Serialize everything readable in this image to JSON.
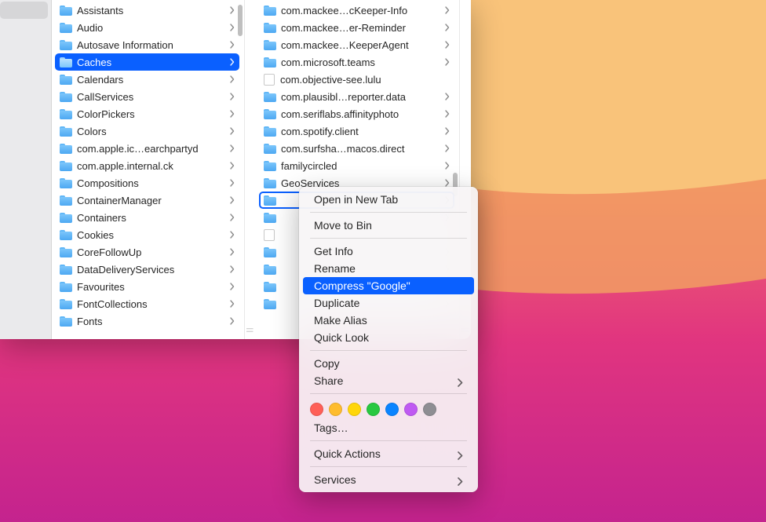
{
  "columns": {
    "col1_selected": "Caches",
    "col1": [
      "Assistants",
      "Audio",
      "Autosave Information",
      "Caches",
      "Calendars",
      "CallServices",
      "ColorPickers",
      "Colors",
      "com.apple.ic…earchpartyd",
      "com.apple.internal.ck",
      "Compositions",
      "ContainerManager",
      "Containers",
      "Cookies",
      "CoreFollowUp",
      "DataDeliveryServices",
      "Favourites",
      "FontCollections",
      "Fonts"
    ],
    "col2_focused_index": 11,
    "col2": [
      {
        "name": "com.mackee…cKeeper-Info",
        "type": "folder"
      },
      {
        "name": "com.mackee…er-Reminder",
        "type": "folder"
      },
      {
        "name": "com.mackee…KeeperAgent",
        "type": "folder"
      },
      {
        "name": "com.microsoft.teams",
        "type": "folder"
      },
      {
        "name": "com.objective-see.lulu",
        "type": "file"
      },
      {
        "name": "com.plausibl…reporter.data",
        "type": "folder"
      },
      {
        "name": "com.seriflabs.affinityphoto",
        "type": "folder"
      },
      {
        "name": "com.spotify.client",
        "type": "folder"
      },
      {
        "name": "com.surfsha…macos.direct",
        "type": "folder"
      },
      {
        "name": "familycircled",
        "type": "folder"
      },
      {
        "name": "GeoServices",
        "type": "folder"
      },
      {
        "name": "",
        "type": "folder"
      },
      {
        "name": "",
        "type": "folder"
      },
      {
        "name": "",
        "type": "file"
      },
      {
        "name": "",
        "type": "folder"
      },
      {
        "name": "",
        "type": "folder"
      },
      {
        "name": "",
        "type": "folder"
      },
      {
        "name": "",
        "type": "folder"
      }
    ]
  },
  "menu": {
    "open_new_tab": "Open in New Tab",
    "move_to_bin": "Move to Bin",
    "get_info": "Get Info",
    "rename": "Rename",
    "compress": "Compress \"Google\"",
    "duplicate": "Duplicate",
    "make_alias": "Make Alias",
    "quick_look": "Quick Look",
    "copy": "Copy",
    "share": "Share",
    "tags": "Tags…",
    "quick_actions": "Quick Actions",
    "services": "Services"
  },
  "tag_colors": [
    "#ff5f57",
    "#febc2e",
    "#ffd60a",
    "#28c840",
    "#0a84ff",
    "#bf5af2",
    "#8e8e93"
  ]
}
